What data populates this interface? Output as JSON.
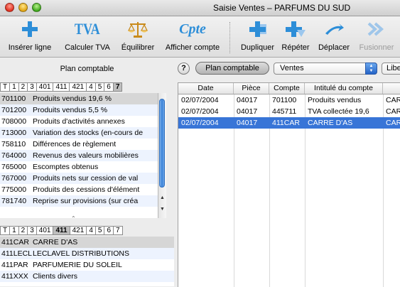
{
  "window": {
    "title": "Saisie Ventes – PARFUMS DU SUD"
  },
  "toolbar": {
    "insert_label": "Insérer ligne",
    "vat_label": "Calculer TVA",
    "vat_glyph": "TVA",
    "balance_label": "Équilibrer",
    "account_label": "Afficher compte",
    "account_glyph": "Cpte",
    "duplicate_label": "Dupliquer",
    "repeat_label": "Répéter",
    "move_label": "Déplacer",
    "merge_label": "Fusionner"
  },
  "left": {
    "header": "Plan comptable",
    "tabs_top": [
      "T",
      "1",
      "2",
      "3",
      "401",
      "411",
      "421",
      "4",
      "5",
      "6",
      "7"
    ],
    "tabs_top_active": "7",
    "accounts_top": [
      {
        "code": "701100",
        "label": "Produits vendus 19,6 %"
      },
      {
        "code": "701200",
        "label": "Produits vendus 5,5 %"
      },
      {
        "code": "708000",
        "label": "Produits d'activités annexes"
      },
      {
        "code": "713000",
        "label": "Variation des stocks (en-cours de"
      },
      {
        "code": "758110",
        "label": "Différences de règlement"
      },
      {
        "code": "764000",
        "label": "Revenus des valeurs mobilières"
      },
      {
        "code": "765000",
        "label": "Escomptes obtenus"
      },
      {
        "code": "767000",
        "label": "Produits nets sur cession de val"
      },
      {
        "code": "775000",
        "label": "Produits des cessions d'élément"
      },
      {
        "code": "781740",
        "label": "Reprise sur provisions (sur créa"
      }
    ],
    "tabs_bottom": [
      "T",
      "1",
      "2",
      "3",
      "401",
      "411",
      "421",
      "4",
      "5",
      "6",
      "7"
    ],
    "tabs_bottom_active": "411",
    "accounts_bottom": [
      {
        "code": "411CAR",
        "label": "CARRE D'AS"
      },
      {
        "code": "411LECL",
        "label": "LECLAVEL DISTRIBUTIONS"
      },
      {
        "code": "411PAR",
        "label": "PARFUMERIE DU SOLEIL"
      },
      {
        "code": "411XXX",
        "label": "Clients divers"
      }
    ]
  },
  "right": {
    "help": "?",
    "plan_button": "Plan comptable",
    "journal": "Ventes",
    "libelle_button": "Libe",
    "columns": [
      "Date",
      "Pièce",
      "Compte",
      "Intitulé du compte",
      ""
    ],
    "rows": [
      {
        "date": "02/07/2004",
        "piece": "04017",
        "compte": "701100",
        "intitule": "Produits vendus",
        "libelle": "CAR"
      },
      {
        "date": "02/07/2004",
        "piece": "04017",
        "compte": "445711",
        "intitule": "TVA collectée 19,6",
        "libelle": "CAR"
      },
      {
        "date": "02/07/2004",
        "piece": "04017",
        "compte": "411CAR",
        "intitule": "CARRE D'AS",
        "libelle": "CAR"
      }
    ],
    "selected_row": 2
  },
  "colors": {
    "accent": "#3875d7",
    "icon_blue": "#2d8ed8"
  }
}
